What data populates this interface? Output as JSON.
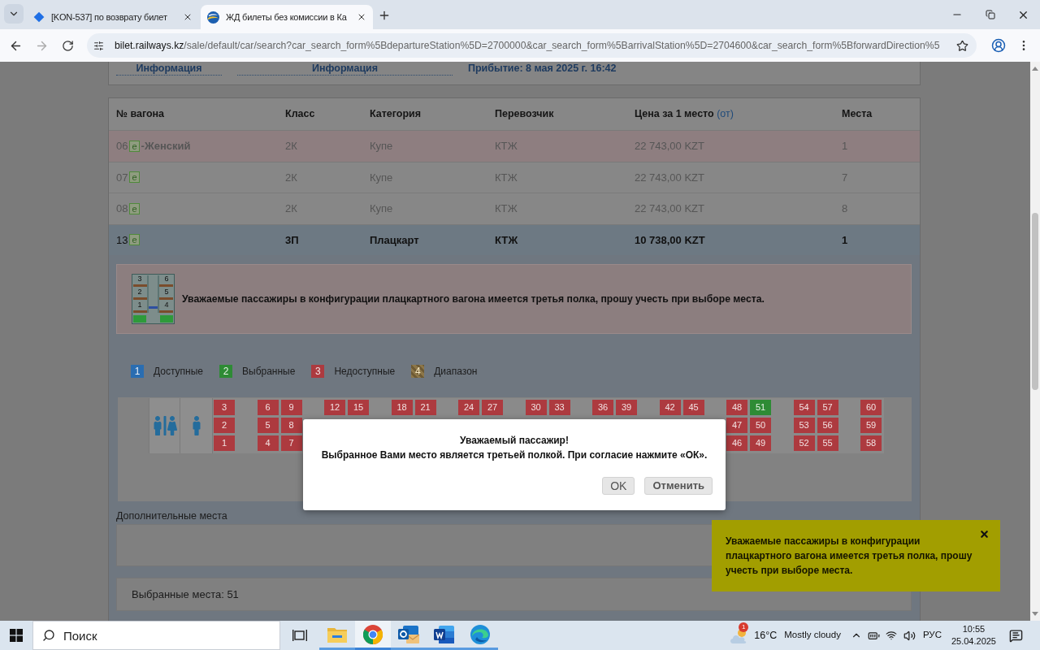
{
  "browser": {
    "tabs": [
      {
        "title": "[KON-537] по возврату билет",
        "kind": "diamond",
        "selected": false
      },
      {
        "title": "ЖД билеты без комиссии в Ка",
        "kind": "rail",
        "selected": true
      }
    ],
    "url": {
      "host": "bilet.railways.kz",
      "path": "/sale/default/car/search?car_search_form%5BdepartureStation%5D=2700000&car_search_form%5BarrivalStation%5D=2704600&car_search_form%5BforwardDirection%5"
    }
  },
  "trip_info": {
    "links": [
      "Информация",
      "Информация"
    ],
    "arrival": "Прибытие: 8 мая 2025 г. 16:42"
  },
  "table": {
    "columns": [
      {
        "label": "№ вагона"
      },
      {
        "label": "Класс"
      },
      {
        "label": "Категория"
      },
      {
        "label": "Перевозчик"
      },
      {
        "label": "Цена за 1 место",
        "note": "(от)"
      },
      {
        "label": "Места"
      }
    ],
    "rows": [
      {
        "car": "06",
        "badge": "e",
        "note": "-Женский",
        "kind": "female",
        "class": "2К",
        "category": "Купе",
        "carrier": "КТЖ",
        "price": "22 743,00 KZT",
        "seats": "1",
        "selected": false
      },
      {
        "car": "07",
        "badge": "e",
        "kind": "regular",
        "class": "2К",
        "category": "Купе",
        "carrier": "КТЖ",
        "price": "22 743,00 KZT",
        "seats": "7",
        "selected": false
      },
      {
        "car": "08",
        "badge": "e",
        "kind": "regular",
        "class": "2К",
        "category": "Купе",
        "carrier": "КТЖ",
        "price": "22 743,00 KZT",
        "seats": "8",
        "selected": false
      },
      {
        "car": "13",
        "badge": "e",
        "kind": "regular",
        "class": "3П",
        "category": "Плацкарт",
        "carrier": "КТЖ",
        "price": "10 738,00 KZT",
        "seats": "1",
        "selected": true
      }
    ]
  },
  "notice": {
    "diagram_labels": [
      "3",
      "6",
      "2",
      "5",
      "1",
      "4"
    ],
    "text": "Уважаемые пассажиры в конфигурации плацкартного вагона имеется третья полка, прошу учесть при выборе места."
  },
  "legend": [
    {
      "number": "1",
      "label": "Доступные",
      "kind": "available"
    },
    {
      "number": "2",
      "label": "Выбранные",
      "kind": "selected"
    },
    {
      "number": "3",
      "label": "Недоступные",
      "kind": "unavailable"
    },
    {
      "number": "4",
      "label": "Диапазон",
      "kind": "range"
    }
  ],
  "seat_map": {
    "facilities": [
      {
        "kind": "restroom"
      },
      {
        "kind": "male"
      }
    ],
    "compartments": [
      {
        "columns": [
          {
            "top": {
              "number": "3",
              "available": false,
              "selected": false
            },
            "middle": {
              "number": "2",
              "available": false,
              "selected": false
            },
            "bottom": {
              "number": "1",
              "available": false,
              "selected": false
            }
          }
        ]
      },
      {
        "columns": [
          {
            "top": {
              "number": "6",
              "available": false,
              "selected": false
            },
            "middle": {
              "number": "5",
              "available": false,
              "selected": false
            },
            "bottom": {
              "number": "4",
              "available": false,
              "selected": false
            }
          },
          {
            "top": {
              "number": "9",
              "available": false,
              "selected": false
            },
            "middle": {
              "number": "8",
              "available": false,
              "selected": false
            },
            "bottom": {
              "number": "7",
              "available": false,
              "selected": false
            }
          }
        ]
      },
      {
        "columns": [
          {
            "top": {
              "number": "12",
              "available": false,
              "selected": false
            }
          },
          {
            "top": {
              "number": "15",
              "available": false,
              "selected": false
            }
          }
        ]
      },
      {
        "columns": [
          {
            "top": {
              "number": "18",
              "available": false,
              "selected": false
            }
          },
          {
            "top": {
              "number": "21",
              "available": false,
              "selected": false
            }
          }
        ]
      },
      {
        "columns": [
          {
            "top": {
              "number": "24",
              "available": false,
              "selected": false
            }
          },
          {
            "top": {
              "number": "27",
              "available": false,
              "selected": false
            }
          }
        ]
      },
      {
        "columns": [
          {
            "top": {
              "number": "30",
              "available": false,
              "selected": false
            }
          },
          {
            "top": {
              "number": "33",
              "available": false,
              "selected": false
            }
          }
        ]
      },
      {
        "columns": [
          {
            "top": {
              "number": "36",
              "available": false,
              "selected": false
            }
          },
          {
            "top": {
              "number": "39",
              "available": false,
              "selected": false
            }
          }
        ]
      },
      {
        "columns": [
          {
            "top": {
              "number": "42",
              "available": false,
              "selected": false
            }
          },
          {
            "top": {
              "number": "45",
              "available": false,
              "selected": false
            }
          }
        ]
      },
      {
        "columns": [
          {
            "top": {
              "number": "48",
              "available": false,
              "selected": false
            },
            "middle": {
              "number": "47",
              "available": false,
              "selected": false
            },
            "bottom": {
              "number": "46",
              "available": false,
              "selected": false
            }
          },
          {
            "top": {
              "number": "51",
              "available": true,
              "selected": true
            },
            "middle": {
              "number": "50",
              "available": false,
              "selected": false
            },
            "bottom": {
              "number": "49",
              "available": false,
              "selected": false
            }
          }
        ]
      },
      {
        "columns": [
          {
            "top": {
              "number": "54",
              "available": false,
              "selected": false
            },
            "middle": {
              "number": "53",
              "available": false,
              "selected": false
            },
            "bottom": {
              "number": "52",
              "available": false,
              "selected": false
            }
          },
          {
            "top": {
              "number": "57",
              "available": false,
              "selected": false
            },
            "middle": {
              "number": "56",
              "available": false,
              "selected": false
            },
            "bottom": {
              "number": "55",
              "available": false,
              "selected": false
            }
          }
        ]
      },
      {
        "columns": [
          {
            "top": {
              "number": "60",
              "available": false,
              "selected": false
            },
            "middle": {
              "number": "59",
              "available": false,
              "selected": false
            },
            "bottom": {
              "number": "58",
              "available": false,
              "selected": false
            }
          }
        ]
      }
    ]
  },
  "extra_seats": {
    "label": "Дополнительные места"
  },
  "selected_seats": {
    "text": "Выбранные места: 51"
  },
  "dialog": {
    "title": "Уважаемый пассажир!",
    "message": "Выбранное Вами место является третьей полкой. При согласие нажмите «ОК».",
    "buttons": [
      {
        "label": "OK",
        "kind": "confirm"
      },
      {
        "label": "Отменить",
        "kind": "cancel"
      }
    ]
  },
  "toast": {
    "text": "Уважаемые пассажиры в конфигурации плацкартного вагона имеется третья полка, прошу учесть при выборе места."
  },
  "taskbar": {
    "search": {
      "placeholder": "Поиск"
    },
    "apps": [
      {
        "kind": "folder",
        "selected": false
      },
      {
        "kind": "browser",
        "selected": true
      },
      {
        "kind": "mail",
        "selected": false
      },
      {
        "kind": "document",
        "selected": false
      },
      {
        "kind": "web",
        "selected": false
      }
    ],
    "weather": {
      "badge": "1",
      "temperature": "16°C",
      "condition": "Mostly cloudy"
    },
    "language": "РУС",
    "time": "10:55",
    "date": "25.04.2025"
  }
}
